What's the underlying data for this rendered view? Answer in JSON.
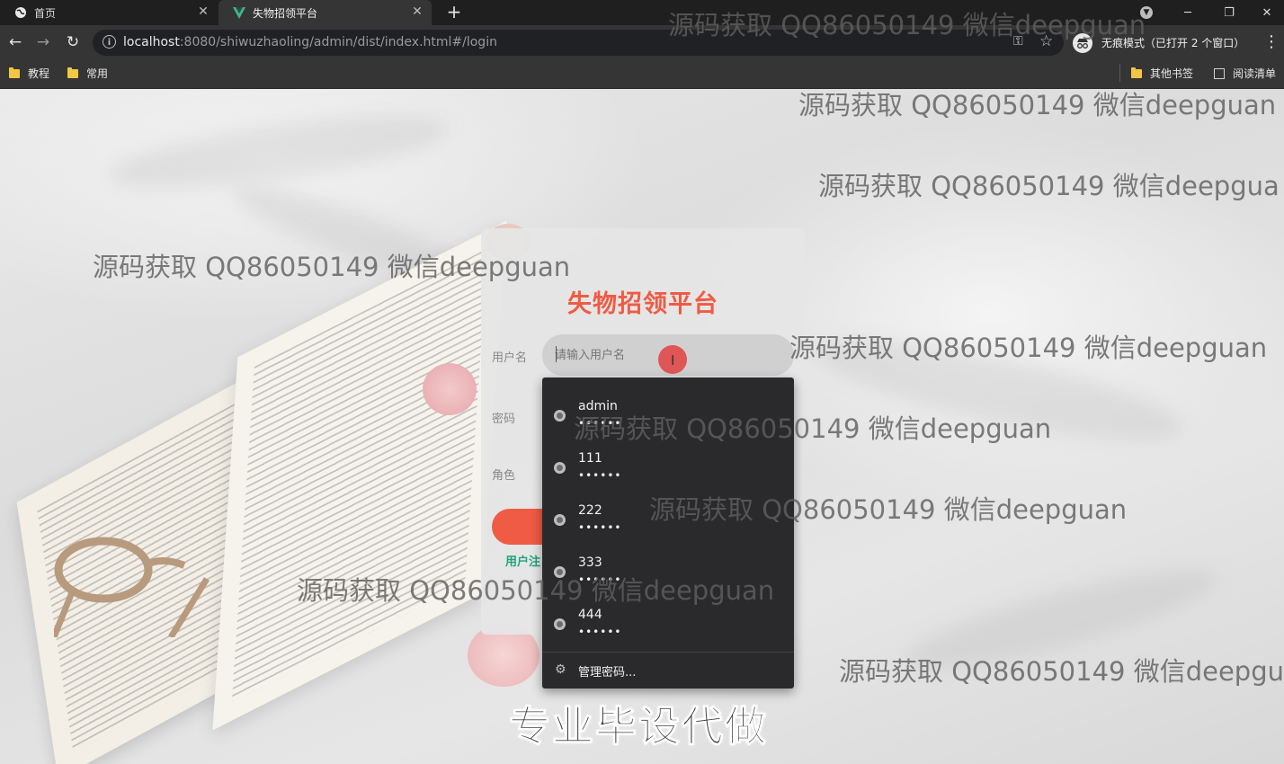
{
  "browser": {
    "tabs": [
      {
        "label": "首页",
        "icon": "globe-icon"
      },
      {
        "label": "失物招领平台",
        "icon": "vue-logo-icon"
      }
    ],
    "url_host": "localhost",
    "url_rest": ":8080/shiwuzhaoling/admin/dist/index.html#/login",
    "incognito_label": "无痕模式（已打开 2 个窗口）",
    "bookmarks": [
      {
        "label": "教程"
      },
      {
        "label": "常用"
      }
    ],
    "other_bookmarks": "其他书签",
    "reading_list": "阅读清单"
  },
  "login": {
    "title": "失物招领平台",
    "username_label": "用户名",
    "username_placeholder": "请输入用户名",
    "password_label": "密码",
    "role_label": "角色",
    "register_link": "用户注"
  },
  "autofill": {
    "accounts": [
      {
        "user": "admin",
        "pw": "••••••"
      },
      {
        "user": "111",
        "pw": "••••••"
      },
      {
        "user": "222",
        "pw": "••••••"
      },
      {
        "user": "333",
        "pw": "••••••"
      },
      {
        "user": "444",
        "pw": "••••••"
      }
    ],
    "manage_label": "管理密码..."
  },
  "watermarks": [
    "源码获取 QQ86050149 微信deepguan",
    "源码获取 QQ86050149 微信deepguan",
    "源码获取 QQ86050149 微信deepgua",
    "源码获取 QQ86050149 微信deepguan",
    "源码获取 QQ86050149 微信deepguan",
    "源码获取 QQ86050149 微信deepguan",
    "源码获取 QQ86050149 微信deepguan",
    "源码获取 QQ86050149 微信deepguan",
    "源码获取 QQ86050149 微信deepgu"
  ],
  "banner": "专业毕设代做",
  "colors": {
    "accent": "#ef5b44",
    "link": "#1fa37a"
  }
}
